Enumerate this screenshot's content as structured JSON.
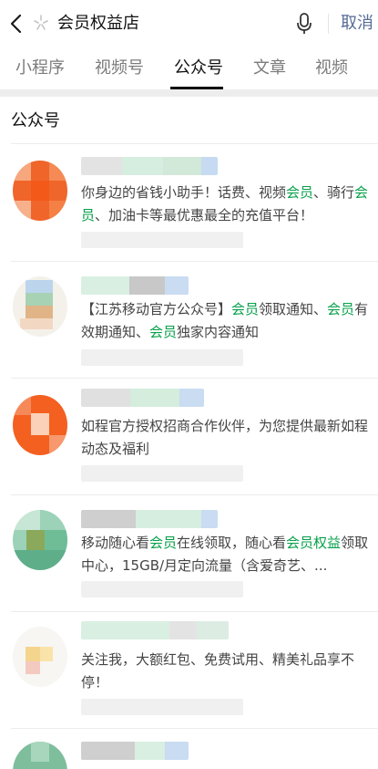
{
  "search": {
    "query": "会员权益店",
    "cancel_label": "取消"
  },
  "tabs": [
    "小程序",
    "视频号",
    "公众号",
    "文章",
    "视频"
  ],
  "section_title": "公众号",
  "results": [
    {
      "desc_parts": [
        {
          "t": "你身边的省钱小助手！话费、视频"
        },
        {
          "t": "会员",
          "hl": true
        },
        {
          "t": "、骑行"
        },
        {
          "t": "会员",
          "hl": true
        },
        {
          "t": "、加油卡等最优惠最全的充值平台！"
        }
      ]
    },
    {
      "desc_parts": [
        {
          "t": "【江苏移动官方公众号】"
        },
        {
          "t": "会员",
          "hl": true
        },
        {
          "t": "领取通知、"
        },
        {
          "t": "会员",
          "hl": true
        },
        {
          "t": "有效期通知、"
        },
        {
          "t": "会员",
          "hl": true
        },
        {
          "t": "独家内容通知"
        }
      ]
    },
    {
      "desc_parts": [
        {
          "t": "如程官方授权招商合作伙伴，为您提供最新如程动态及福利"
        }
      ]
    },
    {
      "desc_parts": [
        {
          "t": "移动随心看"
        },
        {
          "t": "会员",
          "hl": true
        },
        {
          "t": "在线领取，随心看"
        },
        {
          "t": "会员权益",
          "hl": true
        },
        {
          "t": "领取中心，15GB/月定向流量（含爱奇艺、..."
        }
      ]
    },
    {
      "desc_parts": [
        {
          "t": "关注我，大额红包、免费试用、精美礼品享不停！"
        }
      ]
    },
    {
      "desc_parts": []
    }
  ],
  "colors": {
    "highlight": "#07a04a",
    "cancel": "#576b95"
  }
}
